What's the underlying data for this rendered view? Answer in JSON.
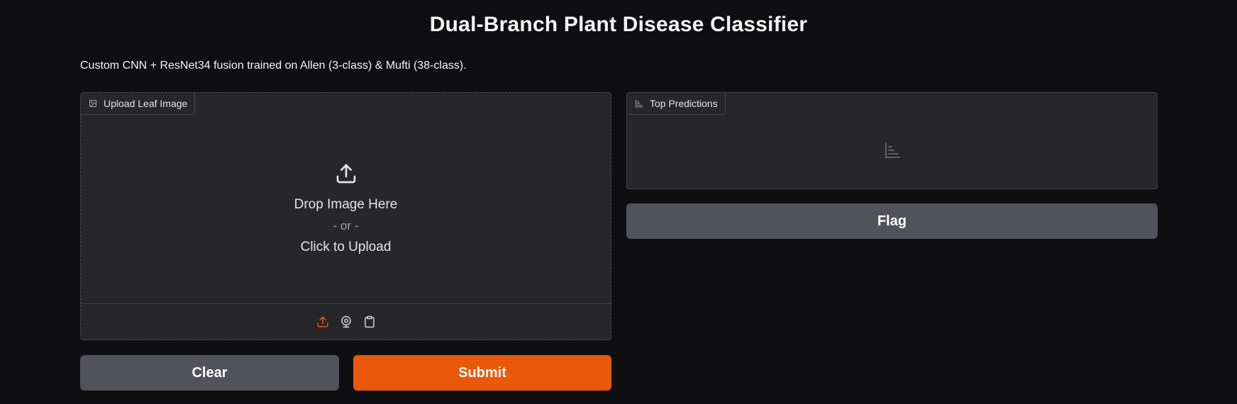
{
  "app": {
    "title": "Dual-Branch Plant Disease Classifier",
    "description": "Custom CNN + ResNet34 fusion trained on Allen (3-class) & Mufti (38-class)."
  },
  "input_panel": {
    "label": "Upload Leaf Image",
    "label_icon": "image-icon",
    "dropzone": {
      "icon": "upload-icon",
      "primary_text": "Drop Image Here",
      "separator_text": "- or -",
      "secondary_text": "Click to Upload"
    },
    "sources": [
      {
        "name": "upload",
        "icon": "upload-icon",
        "active": true
      },
      {
        "name": "webcam",
        "icon": "webcam-icon",
        "active": false
      },
      {
        "name": "clipboard",
        "icon": "clipboard-icon",
        "active": false
      }
    ]
  },
  "output_panel": {
    "label": "Top Predictions",
    "label_icon": "bar-chart-icon",
    "empty_icon": "bar-chart-icon"
  },
  "buttons": {
    "clear": "Clear",
    "submit": "Submit",
    "flag": "Flag"
  },
  "colors": {
    "background": "#0f0f11",
    "panel": "#27272a",
    "accent": "#ea580c",
    "secondary_button": "#52525b"
  }
}
